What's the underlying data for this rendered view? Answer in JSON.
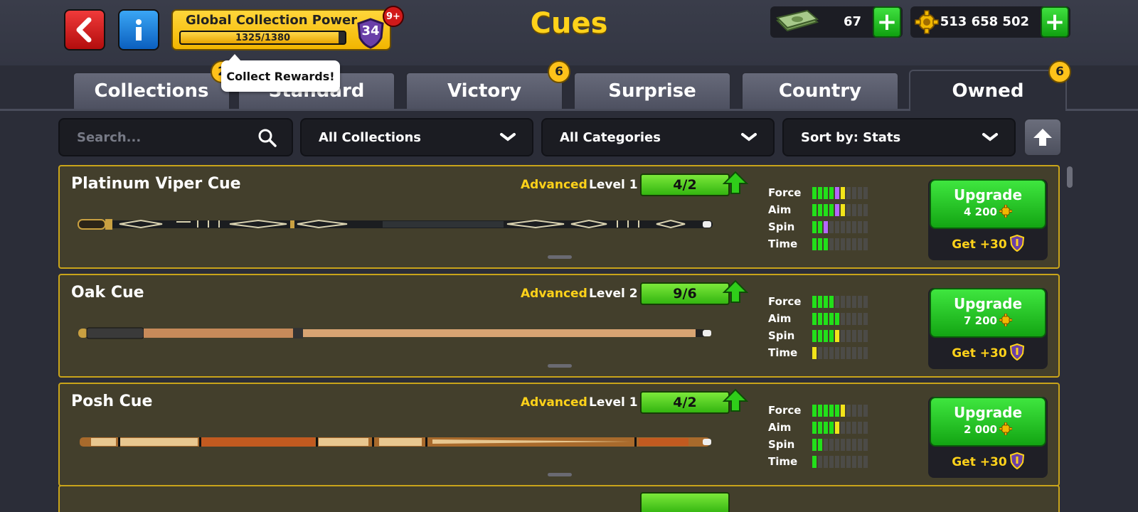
{
  "header": {
    "title": "Cues",
    "collection_power": {
      "label": "Global Collection Power",
      "progress_text": "1325/1380",
      "progress": 0.96,
      "level": "34",
      "notification_badge": "9+"
    },
    "cash": {
      "value": "67"
    },
    "coins": {
      "value": "513 658 502"
    }
  },
  "tabs": [
    {
      "label": "Collections",
      "badge": "2"
    },
    {
      "label": "Standard",
      "badge": ""
    },
    {
      "label": "Victory",
      "badge": "6"
    },
    {
      "label": "Surprise",
      "badge": ""
    },
    {
      "label": "Country",
      "badge": ""
    },
    {
      "label": "Owned",
      "badge": "6",
      "active": true
    }
  ],
  "tooltip": "Collect Rewards!",
  "filters": {
    "search_placeholder": "Search...",
    "collection": "All Collections",
    "category": "All Categories",
    "sort": "Sort by: Stats"
  },
  "stat_labels": [
    "Force",
    "Aim",
    "Spin",
    "Time"
  ],
  "cues": [
    {
      "name": "Platinum Viper Cue",
      "tier": "Advanced",
      "level": "Level 1",
      "progress": "4/2",
      "upgrade_label": "Upgrade",
      "upgrade_cost": "4 200",
      "bonus": "Get +30",
      "stats": {
        "force": [
          4,
          1,
          1
        ],
        "aim": [
          4,
          1,
          1
        ],
        "spin": [
          2,
          1,
          0
        ],
        "time": [
          3,
          0,
          0
        ]
      }
    },
    {
      "name": "Oak Cue",
      "tier": "Advanced",
      "level": "Level 2",
      "progress": "9/6",
      "upgrade_label": "Upgrade",
      "upgrade_cost": "7 200",
      "bonus": "Get +30",
      "stats": {
        "force": [
          4,
          0,
          0
        ],
        "aim": [
          5,
          0,
          0
        ],
        "spin": [
          4,
          0,
          1
        ],
        "time": [
          0,
          0,
          1
        ]
      }
    },
    {
      "name": "Posh Cue",
      "tier": "Advanced",
      "level": "Level 1",
      "progress": "4/2",
      "upgrade_label": "Upgrade",
      "upgrade_cost": "2 000",
      "bonus": "Get +30",
      "stats": {
        "force": [
          5,
          0,
          1
        ],
        "aim": [
          4,
          0,
          1
        ],
        "spin": [
          2,
          0,
          0
        ],
        "time": [
          1,
          0,
          0
        ]
      }
    }
  ],
  "colors": {
    "accent_yellow": "#ffd21a",
    "upgrade_green": "#22c21a",
    "card_border": "#c9a41a"
  }
}
